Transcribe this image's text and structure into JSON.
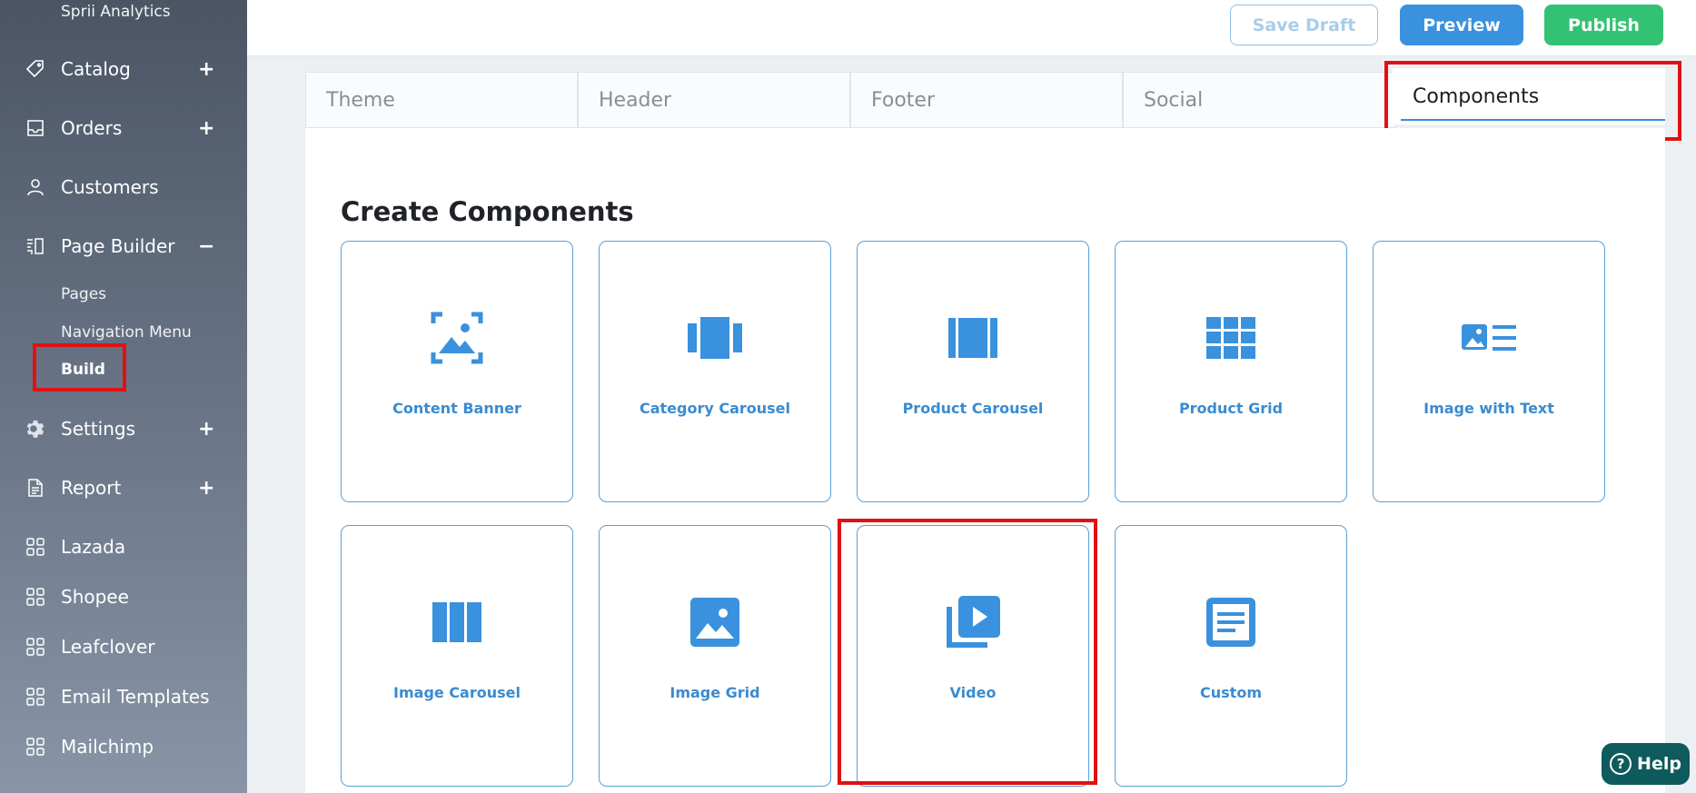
{
  "sidebar": {
    "top_label": "Sprii Analytics",
    "items": [
      {
        "label": "Catalog",
        "icon": "tag-icon",
        "toggle": "+"
      },
      {
        "label": "Orders",
        "icon": "inbox-icon",
        "toggle": "+"
      },
      {
        "label": "Customers",
        "icon": "user-icon",
        "toggle": ""
      },
      {
        "label": "Page Builder",
        "icon": "page-builder-icon",
        "toggle": "−"
      },
      {
        "label": "Settings",
        "icon": "gear-icon",
        "toggle": "+"
      },
      {
        "label": "Report",
        "icon": "document-icon",
        "toggle": "+"
      },
      {
        "label": "Lazada",
        "icon": "grid-icon",
        "toggle": ""
      },
      {
        "label": "Shopee",
        "icon": "grid-icon",
        "toggle": ""
      },
      {
        "label": "Leafclover",
        "icon": "grid-icon",
        "toggle": ""
      },
      {
        "label": "Email Templates",
        "icon": "grid-icon",
        "toggle": ""
      },
      {
        "label": "Mailchimp",
        "icon": "grid-icon",
        "toggle": ""
      }
    ],
    "subitems": [
      "Pages",
      "Navigation Menu",
      "Build"
    ]
  },
  "toolbar": {
    "save_draft": "Save Draft",
    "preview": "Preview",
    "publish": "Publish"
  },
  "tabs": [
    "Theme",
    "Header",
    "Footer",
    "Social",
    "Components"
  ],
  "active_tab": "Components",
  "main": {
    "title": "Create Components",
    "components": [
      {
        "label": "Content Banner",
        "icon": "image-frame-icon"
      },
      {
        "label": "Category Carousel",
        "icon": "carousel-icon"
      },
      {
        "label": "Product Carousel",
        "icon": "product-carousel-icon"
      },
      {
        "label": "Product Grid",
        "icon": "grid-icon"
      },
      {
        "label": "Image with Text",
        "icon": "image-text-icon"
      },
      {
        "label": "Image Carousel",
        "icon": "columns-icon"
      },
      {
        "label": "Image Grid",
        "icon": "image-icon"
      },
      {
        "label": "Video",
        "icon": "video-library-icon"
      },
      {
        "label": "Custom",
        "icon": "article-icon"
      }
    ]
  },
  "help": {
    "label": "Help"
  },
  "colors": {
    "accent": "#3a91dd",
    "publish": "#33c274",
    "highlight": "#e01111"
  }
}
